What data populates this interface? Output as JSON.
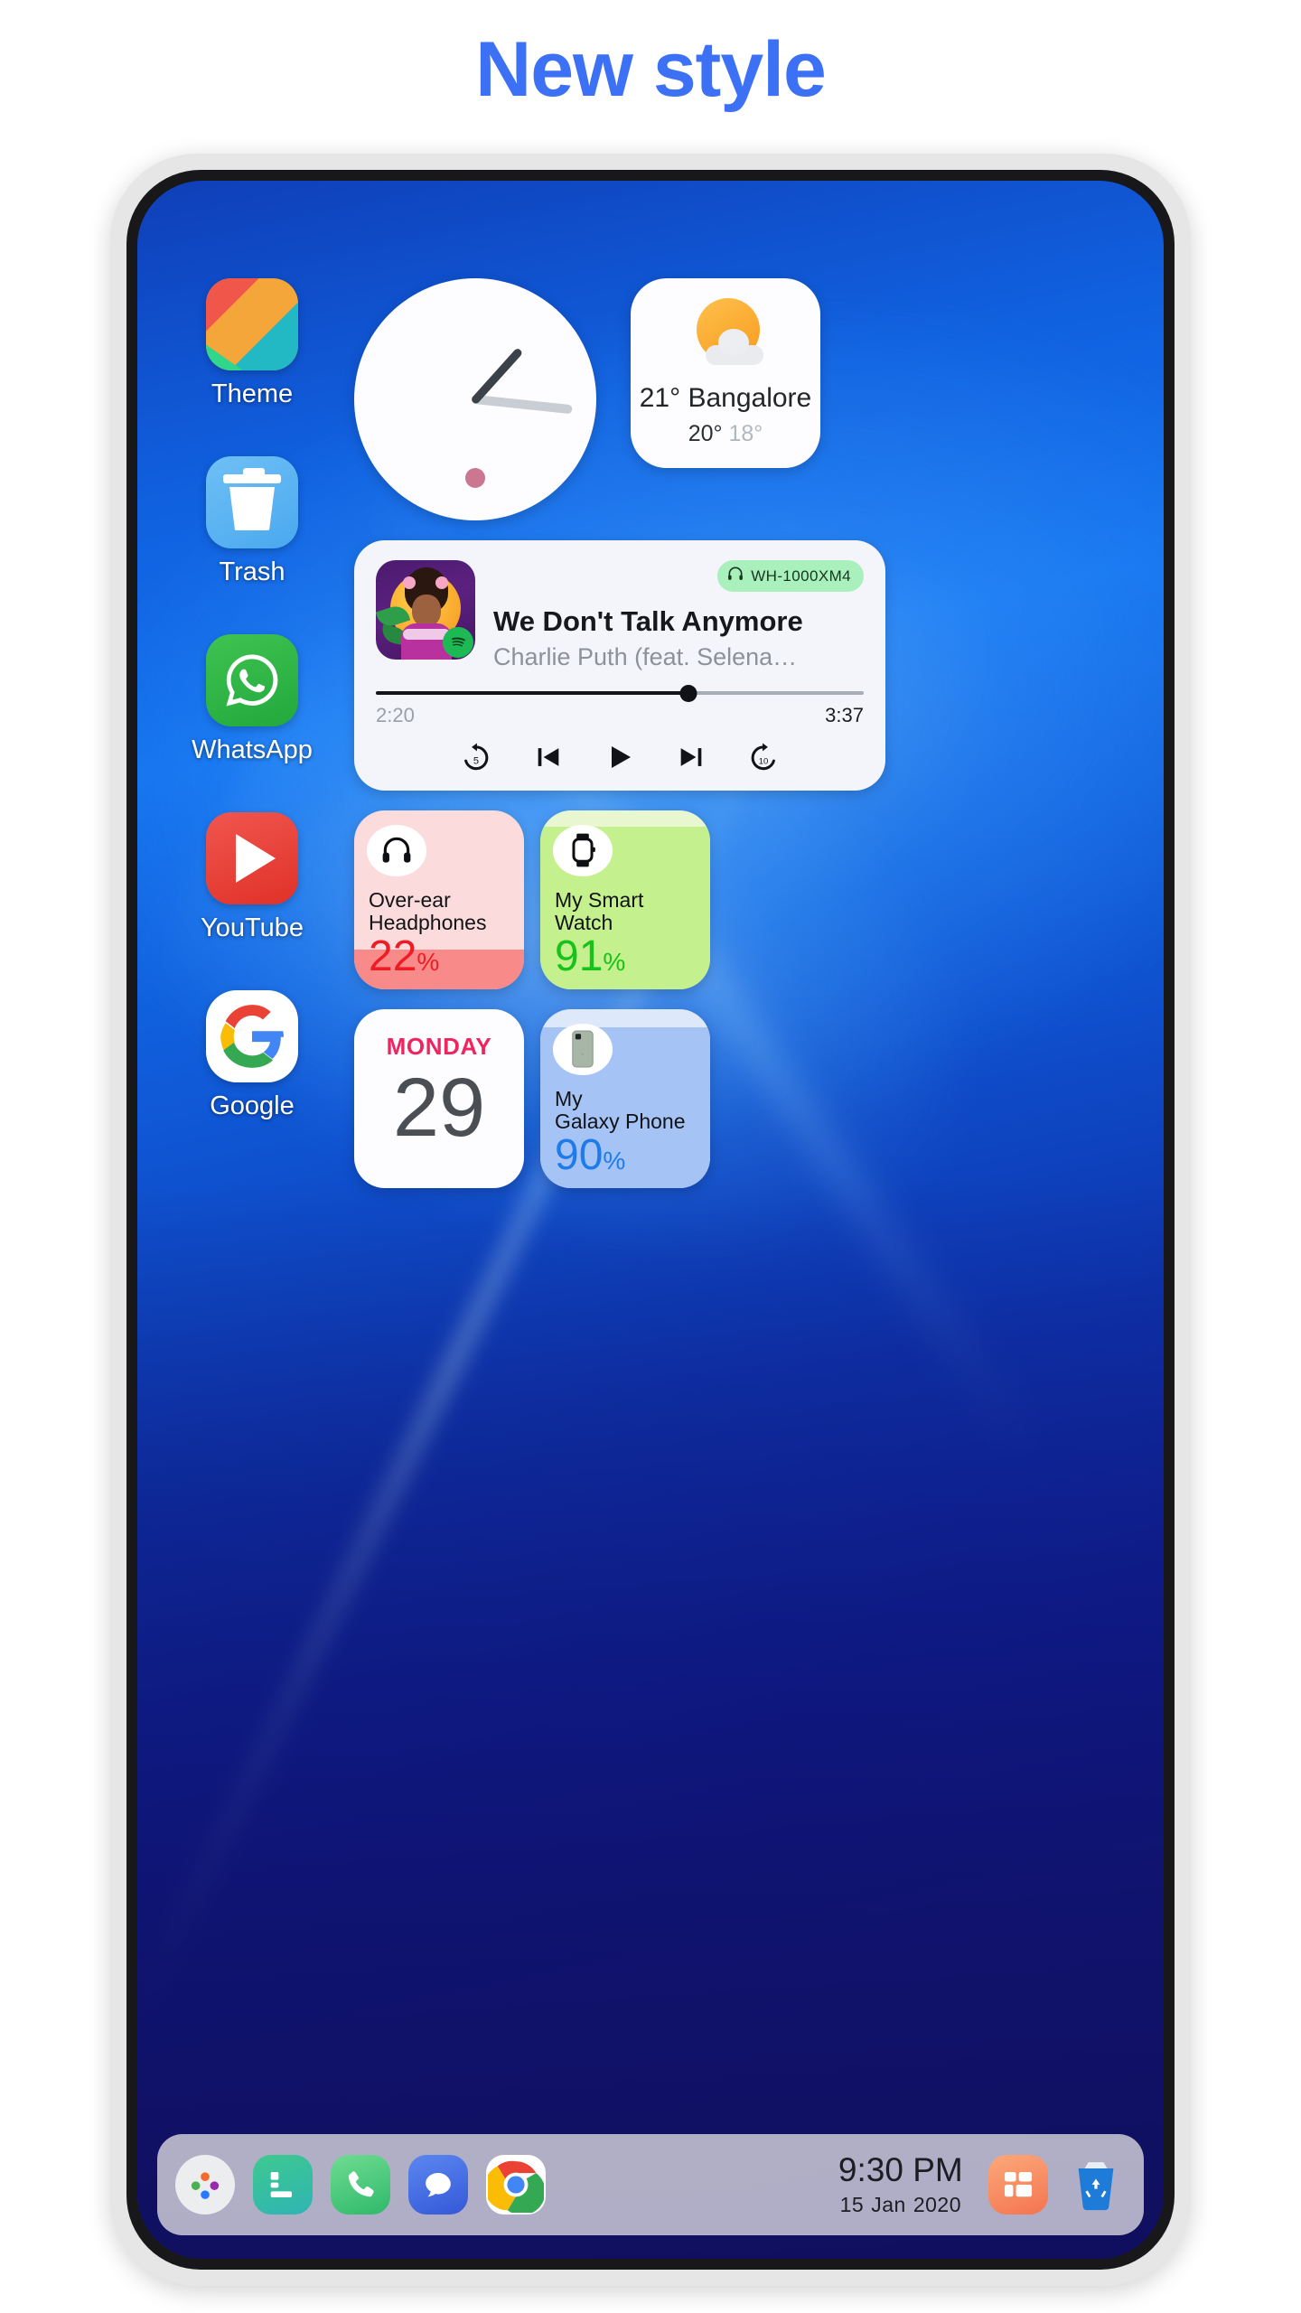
{
  "page": {
    "heading": "New style",
    "accent_color": "#3d71f5"
  },
  "apps": [
    {
      "id": "theme",
      "label": "Theme",
      "icon": "theme-icon"
    },
    {
      "id": "trash",
      "label": "Trash",
      "icon": "trash-icon"
    },
    {
      "id": "whatsapp",
      "label": "WhatsApp",
      "icon": "whatsapp-icon"
    },
    {
      "id": "youtube",
      "label": "YouTube",
      "icon": "youtube-icon"
    },
    {
      "id": "google",
      "label": "Google",
      "icon": "google-icon"
    }
  ],
  "widgets": {
    "clock": {
      "name": "analog-clock-widget",
      "hour_hand_deg": -48,
      "minute_hand_deg": 6,
      "dot_color": "#cc7792"
    },
    "weather": {
      "name": "weather-widget",
      "icon": "sun-behind-cloud-icon",
      "current": "21° Bangalore",
      "high": "20°",
      "low": "18°"
    },
    "music": {
      "name": "music-player-widget",
      "device_badge": "WH-1000XM4",
      "device_icon": "headphones-icon",
      "title": "We Don't Talk Anymore",
      "artist": "Charlie Puth (feat. Selena…",
      "source": "spotify-icon",
      "elapsed": "2:20",
      "total": "3:37",
      "progress_percent": 64,
      "controls": [
        {
          "name": "rewind-5-button",
          "label": "5"
        },
        {
          "name": "previous-button",
          "label": ""
        },
        {
          "name": "play-button",
          "label": ""
        },
        {
          "name": "next-button",
          "label": ""
        },
        {
          "name": "forward-10-button",
          "label": "10"
        }
      ]
    },
    "headphones_battery": {
      "name": "headphones-battery-widget",
      "icon": "headphones-icon",
      "title_line1": "Over-ear",
      "title_line2": "Headphones",
      "value": "22",
      "symbol": "%",
      "percent": 22,
      "color": "#ee1c25"
    },
    "watch_battery": {
      "name": "smartwatch-battery-widget",
      "icon": "smartwatch-icon",
      "title_line1": "My Smart",
      "title_line2": "Watch",
      "value": "91",
      "symbol": "%",
      "percent": 91,
      "color": "#17c21a"
    },
    "calendar": {
      "name": "calendar-widget",
      "weekday": "MONDAY",
      "day": "29"
    },
    "phone_battery": {
      "name": "phone-battery-widget",
      "icon": "smartphone-icon",
      "title_line1": "My",
      "title_line2": "Galaxy Phone",
      "value": "90",
      "symbol": "%",
      "percent": 90,
      "color": "#1f7bea"
    }
  },
  "dock": {
    "items": [
      {
        "id": "app-drawer",
        "icon": "app-drawer-icon"
      },
      {
        "id": "notes",
        "icon": "notes-icon"
      },
      {
        "id": "phone",
        "icon": "phone-icon"
      },
      {
        "id": "messages",
        "icon": "messages-icon"
      },
      {
        "id": "chrome",
        "icon": "chrome-icon"
      }
    ],
    "time": "9:30 PM",
    "date_day": "15",
    "date_month": "Jan",
    "date_year": "2020",
    "right_items": [
      {
        "id": "widgets",
        "icon": "widget-grid-icon"
      },
      {
        "id": "recyclebin",
        "icon": "recycle-bin-icon"
      }
    ]
  }
}
